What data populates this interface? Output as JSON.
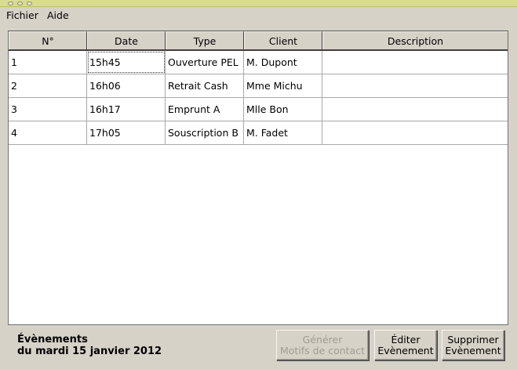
{
  "menu": {
    "file": "Fichier",
    "help": "Aide"
  },
  "table": {
    "headers": [
      "N°",
      "Date",
      "Type",
      "Client",
      "Description"
    ],
    "rows": [
      [
        "1",
        "15h45",
        "Ouverture PEL",
        "M. Dupont",
        ""
      ],
      [
        "2",
        "16h06",
        "Retrait Cash",
        "Mme Michu",
        ""
      ],
      [
        "3",
        "16h17",
        "Emprunt A",
        "Mlle Bon",
        ""
      ],
      [
        "4",
        "17h05",
        "Souscription B",
        "M. Fadet",
        ""
      ]
    ]
  },
  "footer": {
    "title_line1": "Évènements",
    "title_line2": "du mardi 15 janvier 2012",
    "generate_line1": "Générer",
    "generate_line2": "Motifs de contact",
    "edit_line1": "Éditer",
    "edit_line2": "Evènement",
    "delete_line1": "Supprimer",
    "delete_line2": "Evènement"
  }
}
